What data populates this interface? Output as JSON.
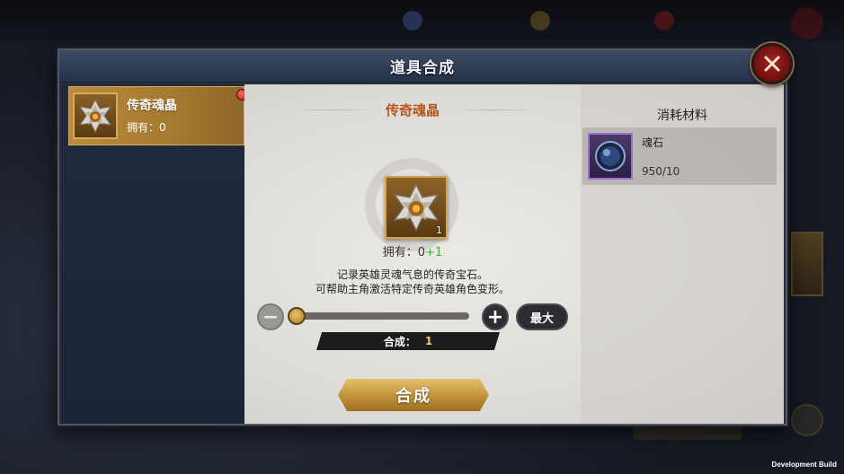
{
  "modal": {
    "title": "道具合成"
  },
  "sidebar": {
    "items": [
      {
        "name": "传奇魂晶",
        "owned": "拥有：0",
        "has_notification": true
      }
    ]
  },
  "detail": {
    "name": "传奇魂晶",
    "icon_count": "1",
    "owned_prefix": "拥有：0",
    "owned_plus": "+1",
    "description_line1": "记录英雄灵魂气息的传奇宝石。",
    "description_line2": "可帮助主角激活特定传奇英雄角色变形。",
    "quantity_fraction": 0,
    "quantity_label": "合成：",
    "quantity_value": "1",
    "max_label": "最大",
    "minus_symbol": "−",
    "plus_symbol": "+",
    "synthesize_label": "合成"
  },
  "materials": {
    "title": "消耗材料",
    "items": [
      {
        "name": "魂石",
        "count": "950/10"
      }
    ]
  },
  "footer": {
    "build_label": "Development Build"
  },
  "colors": {
    "accent_gold": "#c1913a",
    "title_orange": "#b5551f",
    "plus_green": "#3fae3f",
    "close_red": "#a42222"
  }
}
